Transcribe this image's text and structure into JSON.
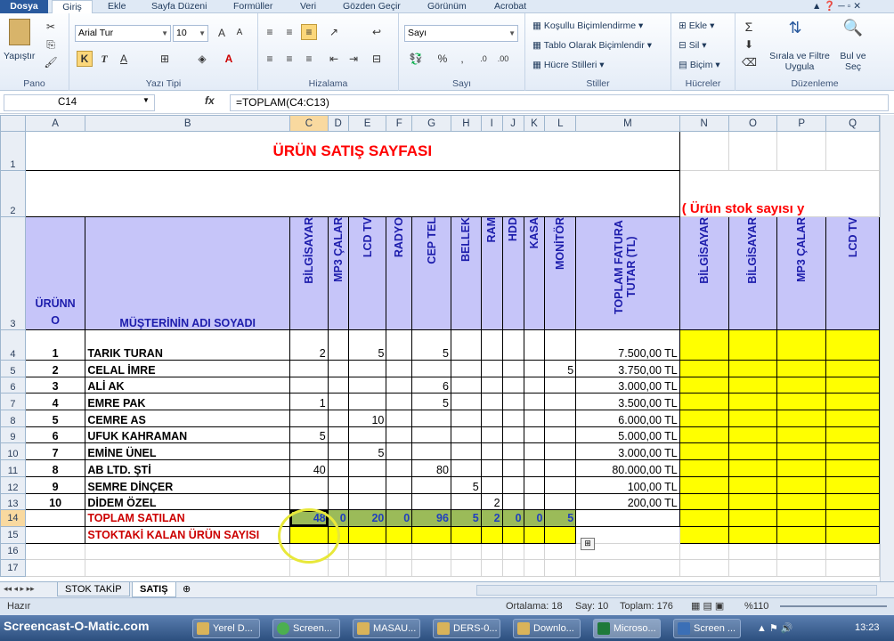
{
  "ribbon": {
    "tabs": [
      "Dosya",
      "Giriş",
      "Ekle",
      "Sayfa Düzeni",
      "Formüller",
      "Veri",
      "Gözden Geçir",
      "Görünüm",
      "Acrobat"
    ],
    "paste": "Yapıştır",
    "font_name": "Arial Tur",
    "font_size": "10",
    "number_format": "Sayı",
    "bold": "K",
    "italic": "T",
    "underline": "A",
    "styles": {
      "cond": "Koşullu Biçimlendirme",
      "table": "Tablo Olarak Biçimlendir",
      "cell": "Hücre Stilleri"
    },
    "cells": {
      "insert": "Ekle",
      "delete": "Sil",
      "format": "Biçim"
    },
    "editing": {
      "sort": "Sırala ve Filtre Uygula",
      "find": "Bul ve Seç"
    },
    "groups": [
      "Pano",
      "Yazı Tipi",
      "Hizalama",
      "Sayı",
      "Stiller",
      "Hücreler",
      "Düzenleme"
    ]
  },
  "formula_bar": {
    "name_box": "C14",
    "fx": "fx",
    "formula": "=TOPLAM(C4:C13)"
  },
  "columns": [
    "A",
    "B",
    "C",
    "D",
    "E",
    "F",
    "G",
    "H",
    "I",
    "J",
    "K",
    "L",
    "M",
    "N",
    "O",
    "P",
    "Q"
  ],
  "title": "ÜRÜN SATIŞ SAYFASI",
  "subtitle": "( Ürün stok sayısı y",
  "headers": {
    "no": "ÜRÜNNO",
    "name": "MÜŞTERİNİN ADI SOYADI",
    "products": [
      "BİLGİSAYAR",
      "MP3 ÇALAR",
      "LCD TV",
      "RADYO",
      "CEP TEL",
      "BELLEK",
      "RAM",
      "HDD",
      "KASA",
      "MONİTÖR"
    ],
    "total": "TOPLAM FATURA TUTAR (TL)",
    "stock": [
      "BİLGİSAYAR",
      "BİLGİSAYAR",
      "MP3 ÇALAR",
      "LCD TV"
    ]
  },
  "rows": [
    {
      "n": "4",
      "no": "1",
      "name": "TARIK TURAN",
      "v": [
        "2",
        "",
        "5",
        "",
        "5",
        "",
        "",
        "",
        "",
        ""
      ],
      "total": "7.500,00 TL"
    },
    {
      "n": "5",
      "no": "2",
      "name": "CELAL İMRE",
      "v": [
        "",
        "",
        "",
        "",
        "",
        "",
        "",
        "",
        "",
        "5"
      ],
      "total": "3.750,00 TL"
    },
    {
      "n": "6",
      "no": "3",
      "name": "ALİ AK",
      "v": [
        "",
        "",
        "",
        "",
        "6",
        "",
        "",
        "",
        "",
        ""
      ],
      "total": "3.000,00 TL"
    },
    {
      "n": "7",
      "no": "4",
      "name": "EMRE PAK",
      "v": [
        "1",
        "",
        "",
        "",
        "5",
        "",
        "",
        "",
        "",
        ""
      ],
      "total": "3.500,00 TL"
    },
    {
      "n": "8",
      "no": "5",
      "name": "CEMRE AS",
      "v": [
        "",
        "",
        "10",
        "",
        "",
        "",
        "",
        "",
        "",
        ""
      ],
      "total": "6.000,00 TL"
    },
    {
      "n": "9",
      "no": "6",
      "name": "UFUK KAHRAMAN",
      "v": [
        "5",
        "",
        "",
        "",
        "",
        "",
        "",
        "",
        "",
        ""
      ],
      "total": "5.000,00 TL"
    },
    {
      "n": "10",
      "no": "7",
      "name": "EMİNE ÜNEL",
      "v": [
        "",
        "",
        "5",
        "",
        "",
        "",
        "",
        "",
        "",
        ""
      ],
      "total": "3.000,00 TL"
    },
    {
      "n": "11",
      "no": "8",
      "name": "AB LTD. ŞTİ",
      "v": [
        "40",
        "",
        "",
        "",
        "80",
        "",
        "",
        "",
        "",
        ""
      ],
      "total": "80.000,00 TL"
    },
    {
      "n": "12",
      "no": "9",
      "name": "SEMRE DİNÇER",
      "v": [
        "",
        "",
        "",
        "",
        "",
        "5",
        "",
        "",
        "",
        ""
      ],
      "total": "100,00 TL"
    },
    {
      "n": "13",
      "no": "10",
      "name": "DİDEM ÖZEL",
      "v": [
        "",
        "",
        "",
        "",
        "",
        "",
        "2",
        "",
        "",
        ""
      ],
      "total": "200,00 TL"
    }
  ],
  "totals": {
    "label": "TOPLAM SATILAN",
    "v": [
      "48",
      "0",
      "20",
      "0",
      "96",
      "5",
      "2",
      "0",
      "0",
      "5"
    ]
  },
  "stock_left": {
    "label": "STOKTAKİ KALAN ÜRÜN SAYISI"
  },
  "sheets": [
    "STOK TAKİP",
    "SATIŞ"
  ],
  "status": {
    "mode": "Hazır",
    "avg": "Ortalama: 18",
    "count": "Say: 10",
    "sum": "Toplam: 176",
    "zoom": "%110"
  },
  "taskbar": {
    "watermark": "Screencast-O-Matic.com",
    "items": [
      "Yerel D...",
      "Screen...",
      "MASAU...",
      "DERS-0...",
      "Downlo...",
      "Microso...",
      "Screen ..."
    ],
    "clock": "13:23"
  },
  "colors": {
    "header_fill": "#c6c5f9",
    "highlight": "#ffff00",
    "total_fill": "#9bbb59",
    "title": "#ff0000"
  }
}
